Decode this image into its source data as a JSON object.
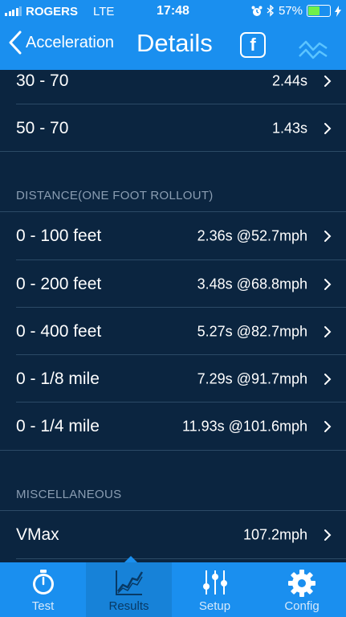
{
  "status_bar": {
    "carrier": "ROGERS",
    "network": "LTE",
    "time": "17:48",
    "battery_percent": "57%",
    "battery_level": 0.57
  },
  "nav": {
    "back_label": "Acceleration",
    "title": "Details",
    "facebook_glyph": "f"
  },
  "sections": {
    "top_rows": [
      {
        "label": "30 - 70",
        "value": "2.44s"
      },
      {
        "label": "50 - 70",
        "value": "1.43s"
      }
    ],
    "distance": {
      "header": "DISTANCE(ONE FOOT ROLLOUT)",
      "rows": [
        {
          "label": "0 - 100 feet",
          "value": "2.36s @52.7mph"
        },
        {
          "label": "0 - 200 feet",
          "value": "3.48s @68.8mph"
        },
        {
          "label": "0 - 400 feet",
          "value": "5.27s @82.7mph"
        },
        {
          "label": "0 - 1/8 mile",
          "value": "7.29s @91.7mph"
        },
        {
          "label": "0 - 1/4 mile",
          "value": "11.93s @101.6mph"
        }
      ]
    },
    "misc": {
      "header": "MISCELLANEOUS",
      "rows": [
        {
          "label": "VMax",
          "value": "107.2mph"
        }
      ]
    }
  },
  "tabbar": {
    "tabs": [
      {
        "label": "Test",
        "icon": "stopwatch-icon"
      },
      {
        "label": "Results",
        "icon": "chart-icon"
      },
      {
        "label": "Setup",
        "icon": "sliders-icon"
      },
      {
        "label": "Config",
        "icon": "gear-icon"
      }
    ],
    "active": "Results"
  },
  "colors": {
    "primary": "#1a8fef",
    "background": "#0b2540",
    "separator": "#2c4a66",
    "section_header": "#8a9db2",
    "battery": "#6ff04a"
  }
}
